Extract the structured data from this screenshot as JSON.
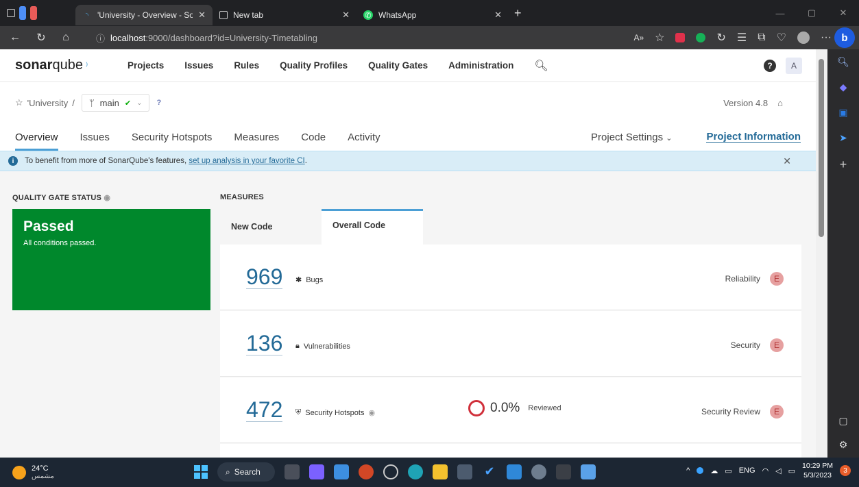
{
  "browser": {
    "tabs": [
      {
        "title": "'University - Overview - SonarQu",
        "icon": "sonarqube-favicon"
      },
      {
        "title": "New tab",
        "icon": "newtab-icon"
      },
      {
        "title": "WhatsApp",
        "icon": "whatsapp-icon"
      }
    ],
    "url_host": "localhost",
    "url_rest": ":9000/dashboard?id=University-Timetabling"
  },
  "sonar": {
    "logo_bold": "sonar",
    "logo_rest": "qube",
    "nav": [
      "Projects",
      "Issues",
      "Rules",
      "Quality Profiles",
      "Quality Gates",
      "Administration"
    ],
    "avatar_letter": "A",
    "help": "?"
  },
  "project": {
    "name": "'University",
    "sep": "/",
    "branch": "main",
    "help": "?",
    "version": "Version 4.8"
  },
  "subnav": {
    "items": [
      "Overview",
      "Issues",
      "Security Hotspots",
      "Measures",
      "Code",
      "Activity"
    ],
    "settings": "Project Settings",
    "info": "Project Information"
  },
  "banner": {
    "text": "To benefit from more of SonarQube's features, ",
    "link": "set up analysis in your favorite CI",
    "end": "."
  },
  "quality_gate": {
    "title": "QUALITY GATE STATUS",
    "status": "Passed",
    "detail": "All conditions passed."
  },
  "measures": {
    "title": "MEASURES",
    "tabs": [
      "New Code",
      "Overall Code"
    ],
    "rows": [
      {
        "value": "969",
        "label": "Bugs",
        "rating_label": "Reliability",
        "grade": "E"
      },
      {
        "value": "136",
        "label": "Vulnerabilities",
        "rating_label": "Security",
        "grade": "E"
      },
      {
        "value": "472",
        "label": "Security Hotspots",
        "rating_label": "Security Review",
        "grade": "E",
        "reviewed_pct": "0.0%",
        "reviewed_label": "Reviewed"
      }
    ]
  },
  "taskbar": {
    "temp": "24°C",
    "weather": "مشمس",
    "search": "Search",
    "lang": "ENG",
    "time": "10:29 PM",
    "date": "5/3/2023",
    "notif": "3"
  }
}
